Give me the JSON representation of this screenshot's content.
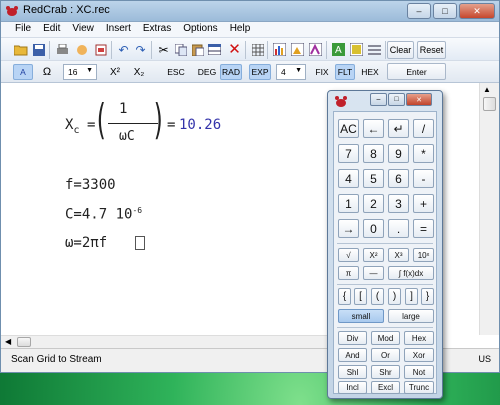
{
  "window": {
    "title": "RedCrab : XC.rec",
    "min_label": "–",
    "max_label": "□",
    "close_label": "✕"
  },
  "menu": [
    "File",
    "Edit",
    "View",
    "Insert",
    "Extras",
    "Options",
    "Help"
  ],
  "toolbar1": {
    "icons": [
      "open-folder-icon",
      "save-icon",
      "print-icon",
      "hand-icon",
      "export-icon",
      "undo-icon",
      "redo-icon",
      "cut-icon",
      "copy-icon",
      "paste-icon",
      "table-icon",
      "delete-icon",
      "grid-icon",
      "chart-bar-icon",
      "chart-image-icon",
      "chart-text-icon",
      "letter-a-icon",
      "picture-icon",
      "lines-icon"
    ],
    "clear_label": "Clear",
    "reset_label": "Reset"
  },
  "toolbar2": {
    "font_a": "A",
    "omega": "Ω",
    "font_size": "16",
    "superscript": "X²",
    "subscript": "X₂",
    "esc": "ESC",
    "deg": "DEG",
    "rad": "RAD",
    "exp": "EXP",
    "precision": "4",
    "fix": "FIX",
    "flt": "FLT",
    "hex": "HEX",
    "enter": "Enter"
  },
  "document": {
    "xc_lhs": "X",
    "xc_sub": "c",
    "equals": "=",
    "numerator": "1",
    "denominator": "ωC",
    "result_eq": "=",
    "result": "10.26",
    "line_f": "f=3300",
    "line_c_base": "C=4.7 10",
    "line_c_exp": "-6",
    "line_omega": "ω=2πf"
  },
  "status": {
    "text": "Scan Grid to Stream",
    "lang": "US"
  },
  "calculator": {
    "rows_main": [
      [
        "AC",
        "←",
        "↵",
        "/"
      ],
      [
        "7",
        "8",
        "9",
        "*"
      ],
      [
        "4",
        "5",
        "6",
        "-"
      ],
      [
        "1",
        "2",
        "3",
        "+"
      ],
      [
        "→",
        "0",
        ".",
        "="
      ]
    ],
    "fn_row1": [
      "√",
      "X²",
      "X³",
      "10ˣ"
    ],
    "fn_row2": [
      "π",
      "—",
      "∫ f(x)dx"
    ],
    "brackets": [
      "{",
      "[",
      "(",
      ")",
      "]",
      "}"
    ],
    "size_small": "small",
    "size_large": "large",
    "ops": [
      [
        "Div",
        "Mod",
        "Hex"
      ],
      [
        "And",
        "Or",
        "Xor"
      ],
      [
        "Shl",
        "Shr",
        "Not"
      ],
      [
        "Incl",
        "Excl",
        "Trunc"
      ]
    ]
  },
  "colors": {
    "accent": "#b8d4f5",
    "result_text": "#3333aa",
    "desktop": "#1f9a48"
  }
}
